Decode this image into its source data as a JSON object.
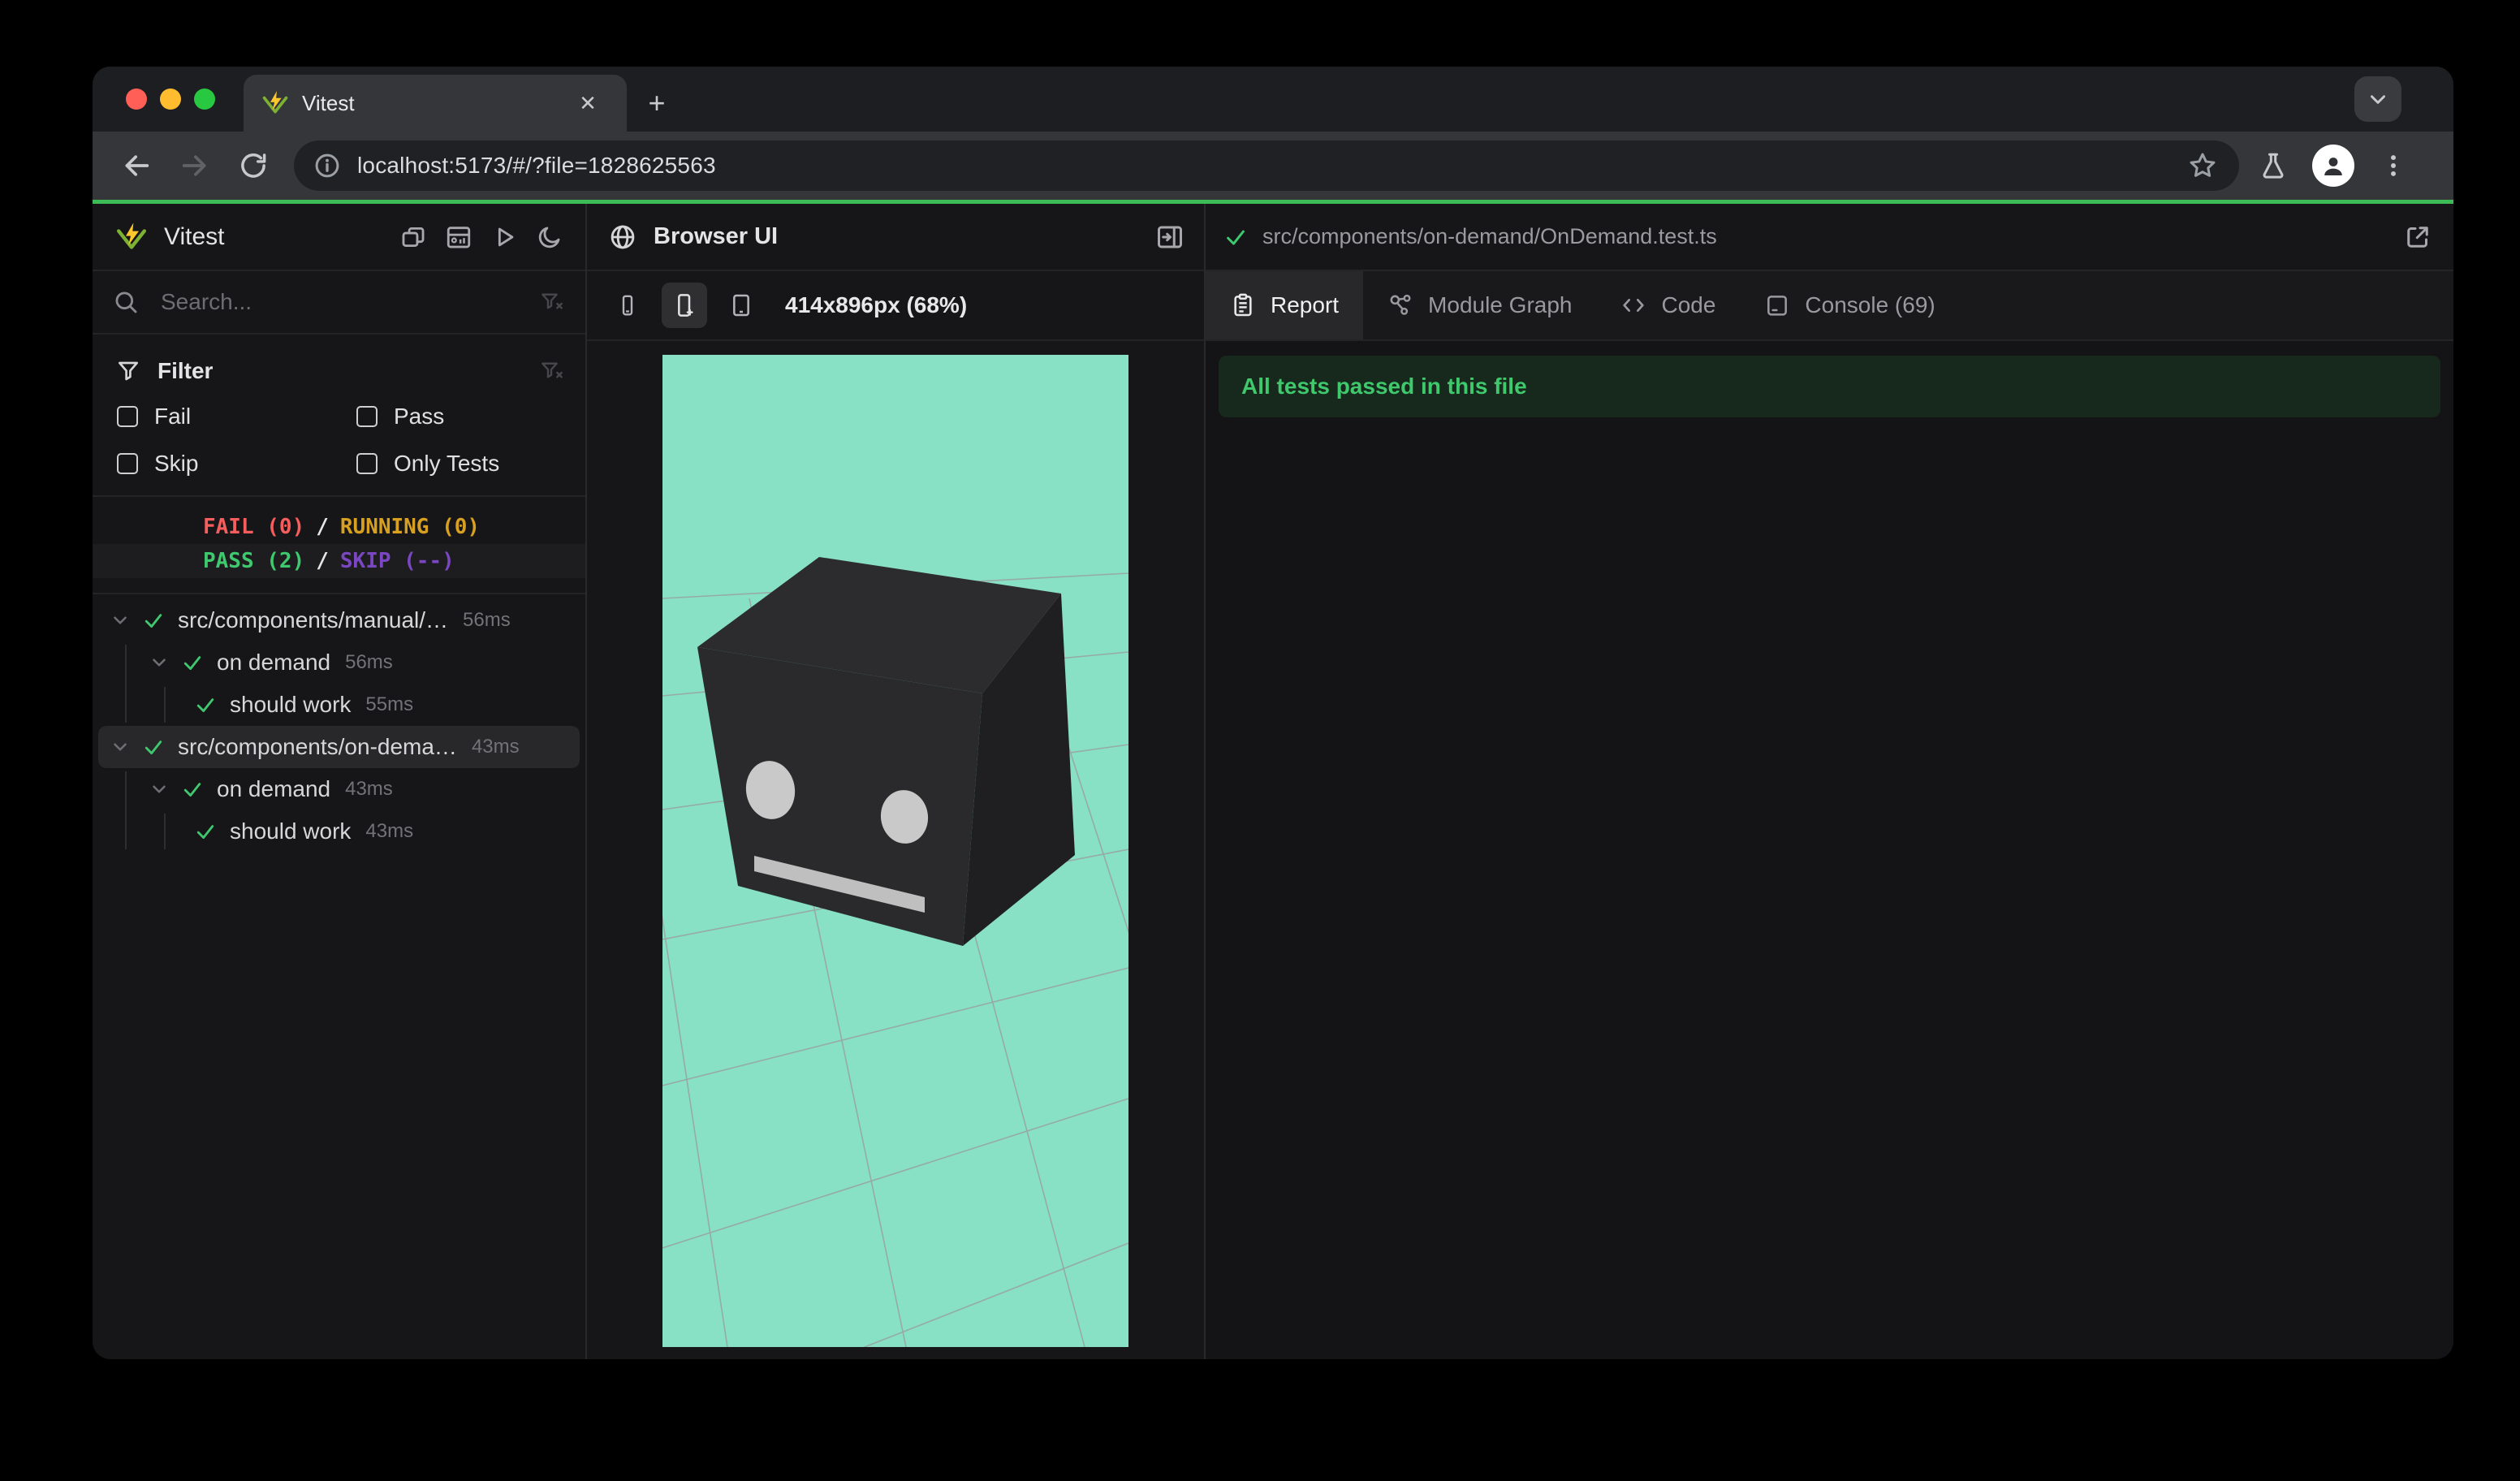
{
  "browser": {
    "tab": {
      "title": "Vitest",
      "close_glyph": "✕",
      "newtab_glyph": "+"
    },
    "url": "localhost:5173/#/?file=1828625563"
  },
  "sidebar": {
    "app_title": "Vitest",
    "search_placeholder": "Search...",
    "filter": {
      "title": "Filter",
      "options": [
        {
          "label": "Fail",
          "checked": false
        },
        {
          "label": "Pass",
          "checked": false
        },
        {
          "label": "Skip",
          "checked": false
        },
        {
          "label": "Only Tests",
          "checked": false
        }
      ]
    },
    "status": {
      "fail": "FAIL (0)",
      "sep": "/",
      "running": "RUNNING (0)",
      "pass": "PASS (2)",
      "skip": "SKIP (--)"
    },
    "tree": [
      {
        "label": "src/components/manual/…",
        "time": "56ms",
        "level": 0,
        "state": "pass",
        "expanded": true
      },
      {
        "label": "on demand",
        "time": "56ms",
        "level": 1,
        "state": "pass",
        "expanded": true
      },
      {
        "label": "should work",
        "time": "55ms",
        "level": 2,
        "state": "pass"
      },
      {
        "label": "src/components/on-dema…",
        "time": "43ms",
        "level": 0,
        "state": "pass",
        "expanded": true,
        "selected": true
      },
      {
        "label": "on demand",
        "time": "43ms",
        "level": 1,
        "state": "pass",
        "expanded": true
      },
      {
        "label": "should work",
        "time": "43ms",
        "level": 2,
        "state": "pass"
      }
    ]
  },
  "browser_panel": {
    "title": "Browser UI",
    "viewport_label": "414x896px (68%)"
  },
  "report_panel": {
    "file_path": "src/components/on-demand/OnDemand.test.ts",
    "file_state": "pass",
    "tabs": [
      {
        "label": "Report",
        "active": true
      },
      {
        "label": "Module Graph",
        "active": false
      },
      {
        "label": "Code",
        "active": false
      },
      {
        "label": "Console (69)",
        "active": false
      }
    ],
    "banner": "All tests passed in this file"
  },
  "colors": {
    "accent_green": "#3cbb56",
    "pass": "#3fc96e",
    "fail": "#f65e5e",
    "running": "#d7a021",
    "skip": "#7a46c2",
    "banner_bg": "#16291c",
    "banner_text": "#3fc86c",
    "viewport_mint": "#88e0c5",
    "traffic_close": "#ff5f57",
    "traffic_minimize": "#febc2e",
    "traffic_zoom": "#28c840"
  }
}
